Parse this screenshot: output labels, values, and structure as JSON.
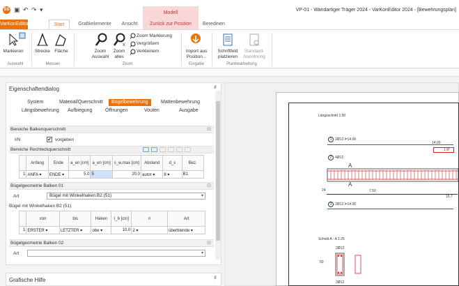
{
  "window": {
    "title": "VP-01 - Wandartiger Träger 2024 - VarKonEditor 2024 - [Bewehrungsplan]",
    "context_tab_header": "Modell",
    "qat_icons": [
      "save-icon",
      "undo-icon",
      "redo-icon",
      "customize-icon"
    ],
    "qat_glyphs": [
      "▣",
      "↶",
      "↷",
      "▾"
    ],
    "app_logo_glyph": "SS"
  },
  "tabs": [
    "VarKonEditor",
    "Start",
    "Grafikelemente",
    "Ansicht",
    "Zurück zur Position",
    "Beredinen"
  ],
  "ribbon": {
    "markieren": "Markieren",
    "strecke": "Strecke",
    "flaeche": "Fläche",
    "zoom_auswahl": [
      "Zoom",
      "Auswahl"
    ],
    "zoom_alles": [
      "Zoom",
      "alles"
    ],
    "zoom_markierung": "Zoom Markierung",
    "vergroessern": "Vergrößern",
    "verkleinern": "Verkleinern",
    "import": [
      "Import aus",
      "Position..."
    ],
    "schriftfeld": [
      "Schriftfeld",
      "platzieren"
    ],
    "standard": [
      "Standard-",
      "Anordnung"
    ],
    "groups": [
      "Auswahl",
      "Messen",
      "Zoom",
      "Eingabe",
      "Planbearbeitung"
    ]
  },
  "panel": {
    "title": "Eigenschaftendialog",
    "pin": "♯",
    "tabs_row1": [
      "System",
      "Material/Querschnitt",
      "Bügelbewehrung",
      "Mattenbewehrung"
    ],
    "tabs_row2": [
      "Längsbewehrung",
      "Aufbiegung",
      "Öffnungen",
      "Vouten",
      "Ausgabe"
    ],
    "sec1": "Bereiche Balkenquerschnitt",
    "in_label": "I/N",
    "vorgeben_check": "✔",
    "vorgeben": "vorgeben",
    "sec2": "Bereiche Rechteckquerschnitt",
    "grid1_headers": [
      "",
      "Anfang",
      "Ende",
      "a_en [cm]",
      "a_en [cm]",
      "s_w,max [cm]",
      "Abstand",
      "d_s",
      "Bez."
    ],
    "grid1_row": [
      "1",
      "ANFA ▾",
      "ENDE ▾",
      "5.0",
      "5",
      "20.0",
      "autor ▾",
      "8 ▾",
      "B1"
    ],
    "sec3": "Bügelgeometrie Balken 01",
    "art_label": "Art",
    "art_value": "Bügel mit Winkelhaken B2 (51)",
    "subheading": "Bügel mit Winkelhaken B2 (51)",
    "grid2_headers": [
      "",
      "von",
      "bis",
      "Haken",
      "l_b [cm]",
      "n",
      "Art"
    ],
    "grid2_row": [
      "1",
      "ERSTER ▾",
      "LETZTER ▾",
      "obe ▾",
      "10.0",
      "2 ▾",
      "überblende ▾"
    ],
    "sec4": "Bügelgeometrie Balken 02",
    "art2_label": "Art",
    "art2_value": ""
  },
  "bottom_panel": {
    "title": "Grafische Hilfe",
    "pin": "♯"
  },
  "drawing": {
    "laengsschnitt": "Längsschnitt 1:50",
    "bar1": "2Ø12 l=14.00",
    "bar2": "4Ø12",
    "bar3": "2Ø12 l=14.00",
    "dim_total": "14.00",
    "dim_mid": "7.50",
    "dim_left": "24",
    "dim_right": "15.7",
    "schnitt": "Schnitt A - A 1:25",
    "sec_bar_top": "2Ø12",
    "sec_bar_bottom": "2Ø12",
    "sec_dim": "60",
    "marker_a": "A",
    "right_label": "1 Ø",
    "circle1": "1",
    "circle2": "2",
    "circle3": "3"
  },
  "colors": {
    "accent": "#e8730c",
    "context": "#c03030",
    "rebar": "#d22222"
  }
}
